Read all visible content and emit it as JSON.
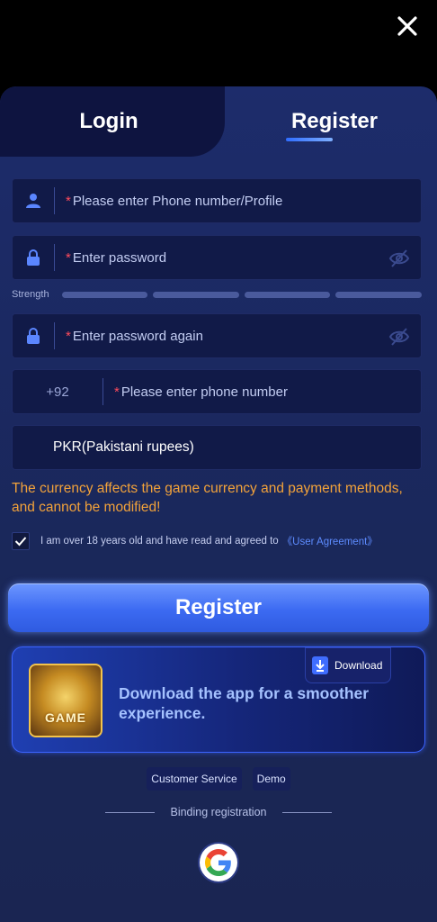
{
  "header": {
    "close_icon": "close-icon"
  },
  "tabs": {
    "login": "Login",
    "register": "Register"
  },
  "form": {
    "phone_profile": {
      "required_mark": "*",
      "placeholder": "Please enter Phone number/Profile",
      "icon": "user-icon"
    },
    "password": {
      "required_mark": "*",
      "placeholder": "Enter password",
      "icon": "lock-icon"
    },
    "strength_label": "Strength",
    "password_again": {
      "required_mark": "*",
      "placeholder": "Enter password again",
      "icon": "lock-icon"
    },
    "phone": {
      "country_code": "+92",
      "required_mark": "*",
      "placeholder": "Please enter phone number"
    },
    "currency": {
      "value": "PKR(Pakistani rupees)"
    }
  },
  "currency_note": "The currency affects the game currency and payment methods, and cannot be modified!",
  "agreement": {
    "text": "I am over 18 years old and have read and agreed to",
    "link": "《User Agreement》",
    "checked": true
  },
  "register_button": "Register",
  "app_banner": {
    "download_label": "Download",
    "message": "Download the app for a smoother experience.",
    "logo_text": "GAME"
  },
  "footer": {
    "customer_service": "Customer Service",
    "demo": "Demo",
    "binding_registration": "Binding registration"
  },
  "colors": {
    "accent": "#3c6af2",
    "warning": "#f2a23a",
    "required": "#ff4b5c",
    "link": "#5d8cff"
  }
}
